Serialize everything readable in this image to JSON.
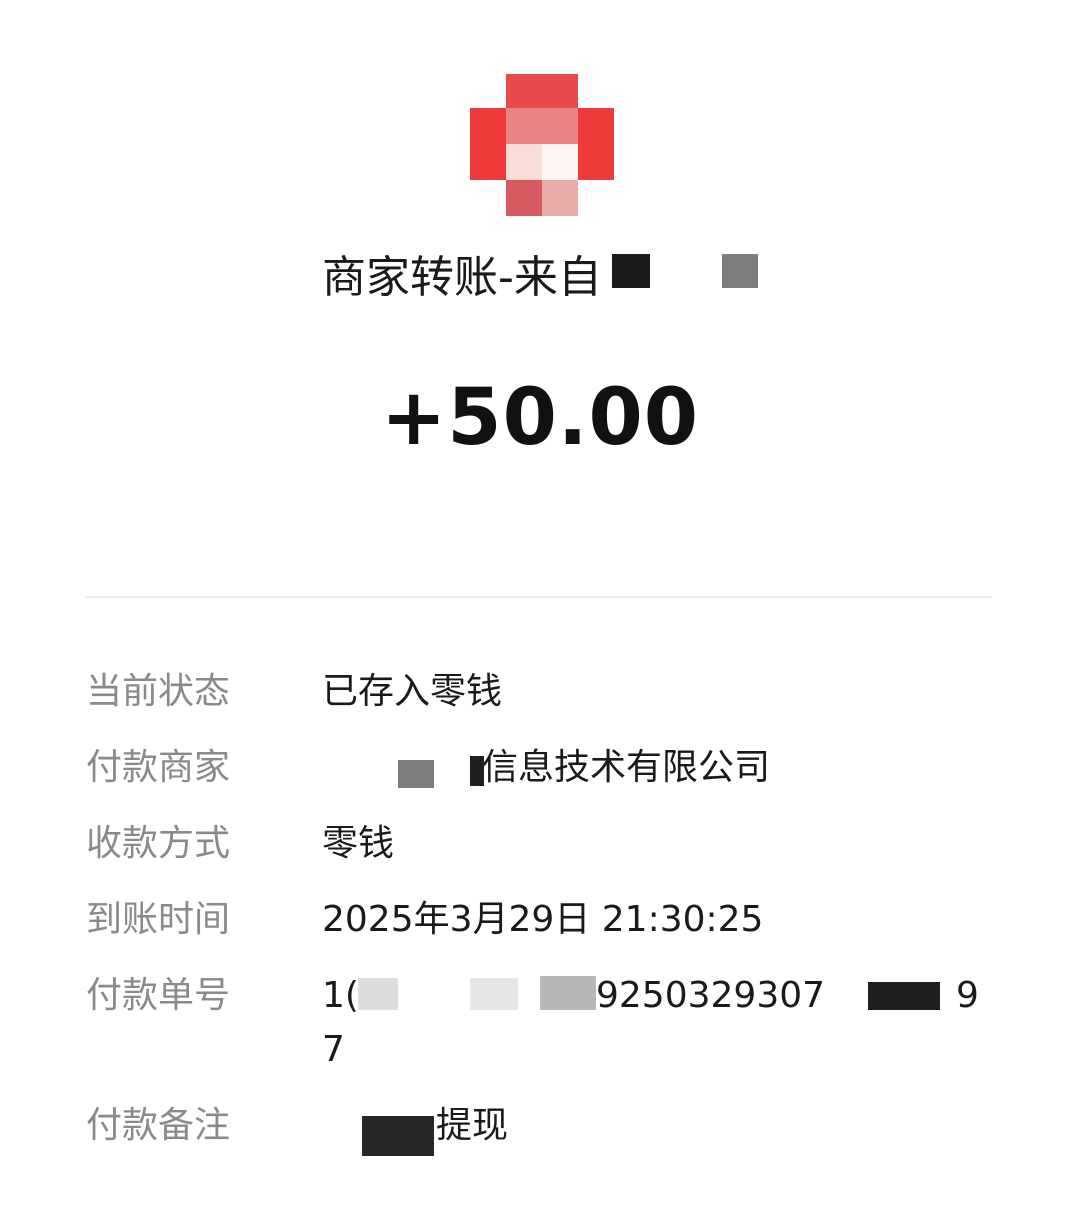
{
  "header": {
    "avatar_icon": "pixelated-red-logo",
    "title": "商家转账-来自",
    "amount": "+50.00"
  },
  "details": {
    "status": {
      "label": "当前状态",
      "value": "已存入零钱"
    },
    "payer": {
      "label": "付款商家",
      "value": "信息技术有限公司"
    },
    "method": {
      "label": "收款方式",
      "value": "零钱"
    },
    "arrival_time": {
      "label": "到账时间",
      "value": "2025年3月29日 21:30:25"
    },
    "order_no": {
      "label": "付款单号",
      "value_prefix": "1(",
      "value_mid": "9250329307",
      "value_end": "9",
      "value_line2": "7"
    },
    "remark": {
      "label": "付款备注",
      "value": "提现"
    }
  },
  "colors": {
    "avatar_red": "#ef3a3a",
    "redact_dark": "#1f1f1f",
    "redact_gray": "#7d7d7d",
    "label_gray": "#8a8a8a",
    "divider": "#ececec"
  }
}
